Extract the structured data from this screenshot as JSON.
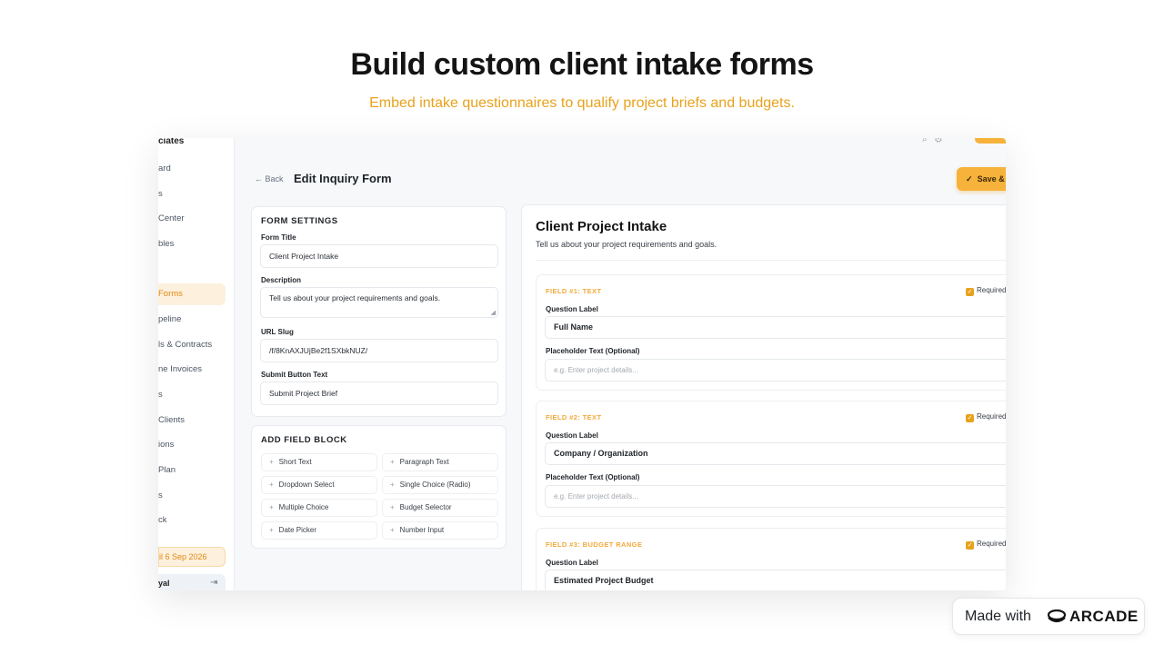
{
  "hero": {
    "title": "Build custom client intake forms",
    "subtitle": "Embed intake questionnaires to qualify project briefs and budgets."
  },
  "sidebar": {
    "brand": "ciates",
    "items": [
      {
        "label": "ard"
      },
      {
        "label": "s"
      },
      {
        "label": "Center"
      },
      {
        "label": "bles"
      },
      {
        "label": ""
      },
      {
        "label": "Forms",
        "active": true
      },
      {
        "label": "peline"
      },
      {
        "label": "ls & Contracts"
      },
      {
        "label": "ne Invoices"
      },
      {
        "label": "s"
      },
      {
        "label": "Clients"
      },
      {
        "label": "ions"
      },
      {
        "label": "Plan"
      },
      {
        "label": "s"
      },
      {
        "label": "ck"
      }
    ],
    "trial": "il 6 Sep 2026",
    "user": "yal"
  },
  "header": {
    "back": "← Back",
    "title": "Edit Inquiry Form",
    "save": "Save &"
  },
  "settings": {
    "title": "FORM SETTINGS",
    "form_title_label": "Form Title",
    "form_title_value": "Client Project Intake",
    "description_label": "Description",
    "description_value": "Tell us about your project requirements and goals.",
    "slug_label": "URL Slug",
    "slug_value": "/f/8KnAXJUjBe2f1SXbkNUZ/",
    "submit_label": "Submit Button Text",
    "submit_value": "Submit Project Brief"
  },
  "add_block": {
    "title": "ADD FIELD BLOCK",
    "chips": [
      "Short Text",
      "Paragraph Text",
      "Dropdown Select",
      "Single Choice (Radio)",
      "Multiple Choice",
      "Budget Selector",
      "Date Picker",
      "Number Input"
    ]
  },
  "preview": {
    "title": "Client Project Intake",
    "description": "Tell us about your project requirements and goals.",
    "fields": [
      {
        "tag": "FIELD #1: TEXT",
        "required": "Required",
        "question_label": "Question Label",
        "question_value": "Full Name",
        "placeholder_label": "Placeholder Text (Optional)",
        "placeholder_value": "e.g. Enter project details..."
      },
      {
        "tag": "FIELD #2: TEXT",
        "required": "Required",
        "question_label": "Question Label",
        "question_value": "Company / Organization",
        "placeholder_label": "Placeholder Text (Optional)",
        "placeholder_value": "e.g. Enter project details..."
      },
      {
        "tag": "FIELD #3: BUDGET RANGE",
        "required": "Required",
        "question_label": "Question Label",
        "question_value": "Estimated Project Budget"
      }
    ]
  },
  "badge": {
    "made_with": "Made with",
    "brand": "ARCADE"
  },
  "colors": {
    "accent": "#f6b23a",
    "accent_text": "#e8a21c"
  }
}
